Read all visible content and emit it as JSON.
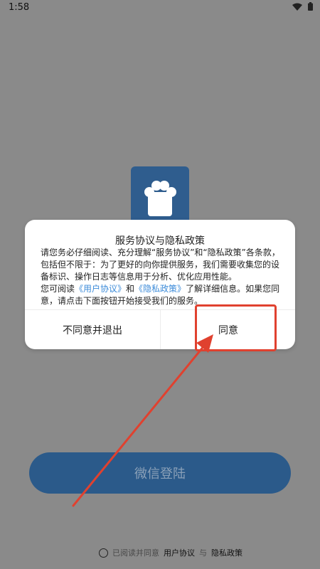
{
  "status_bar": {
    "time": "1:58",
    "icons": [
      "wifi-icon",
      "battery-icon"
    ]
  },
  "app": {
    "logo_icon": "paw-icon",
    "accent_color": "#2f5d8e"
  },
  "login": {
    "wechat_label": "微信登陆"
  },
  "agreement": {
    "prefix": "已阅读并同意",
    "user_agreement": "用户协议",
    "sep": "与",
    "privacy_policy": "隐私政策",
    "checked": false
  },
  "dialog": {
    "title": "服务协议与隐私政策",
    "para1": "请您务必仔细阅读、充分理解“服务协议”和“隐私政策”各条款，包括但不限于：为了更好的向你提供服务，我们需要收集您的设备标识、操作日志等信息用于分析、优化应用性能。",
    "para2_a": "您可阅读",
    "para2_link1": "《用户协议》",
    "para2_and": "和",
    "para2_link2": "《隐私政策》",
    "para2_b": "了解详细信息。如果您同意，请点击下面按钮开始接受我们的服务。",
    "decline_label": "不同意并退出",
    "agree_label": "同意"
  },
  "annotation": {
    "highlight_color": "#e0412f"
  }
}
